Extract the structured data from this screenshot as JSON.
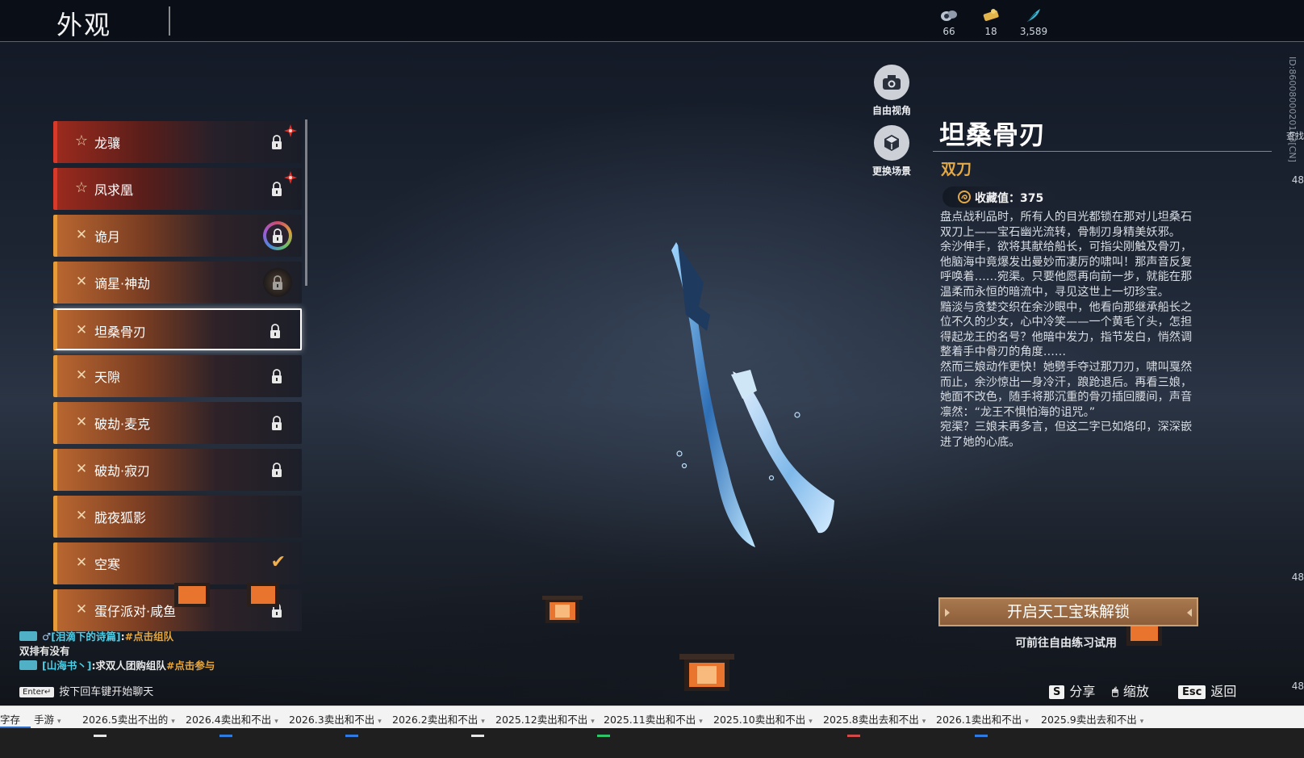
{
  "header": {
    "title": "外观",
    "currencies": [
      {
        "icon": "crystal-icon",
        "value": "66"
      },
      {
        "icon": "ticket-icon",
        "value": "18"
      },
      {
        "icon": "feather-icon",
        "value": "3,589"
      }
    ],
    "side_id": "ID:8600800020163[CN]",
    "edge_numbers": [
      "48",
      "48",
      "48"
    ],
    "edge_text": "查找"
  },
  "list": {
    "items": [
      {
        "label": "龙骧",
        "icon": "star-icon",
        "rarity": "red",
        "state": "locked",
        "new_badge": true
      },
      {
        "label": "凤求凰",
        "icon": "star-icon",
        "rarity": "red",
        "state": "locked",
        "new_badge": true
      },
      {
        "label": "诡月",
        "icon": "shuriken-icon",
        "rarity": "orange",
        "state": "locked-ring"
      },
      {
        "label": "谪星·神劫",
        "icon": "shuriken-icon",
        "rarity": "orange",
        "state": "locked-dark"
      },
      {
        "label": "坦桑骨刃",
        "icon": "shuriken-icon",
        "rarity": "orange",
        "state": "locked",
        "selected": true
      },
      {
        "label": "天隙",
        "icon": "shuriken-icon",
        "rarity": "orange",
        "state": "locked"
      },
      {
        "label": "破劫·麦克",
        "icon": "shuriken-icon",
        "rarity": "orange",
        "state": "locked"
      },
      {
        "label": "破劫·寂刃",
        "icon": "shuriken-icon",
        "rarity": "orange",
        "state": "locked"
      },
      {
        "label": "胧夜狐影",
        "icon": "shuriken-icon",
        "rarity": "orange",
        "state": "none"
      },
      {
        "label": "空寒",
        "icon": "shuriken-icon",
        "rarity": "orange",
        "state": "equipped"
      },
      {
        "label": "蛋仔派对·咸鱼",
        "icon": "shuriken-icon",
        "rarity": "orange",
        "state": "locked"
      }
    ]
  },
  "camera": {
    "free_view": "自由视角",
    "change_scene": "更换场景"
  },
  "detail": {
    "name": "坦桑骨刃",
    "type": "双刀",
    "collection_label": "收藏值：375",
    "description": [
      "盘点战利品时，所有人的目光都锁在那对儿坦桑石双刀上——宝石幽光流转，骨制刃身精美妖邪。",
      "余沙伸手，欲将其献给船长，可指尖刚触及骨刃，他脑海中竟爆发出曼妙而凄厉的啸叫！那声音反复呼唤着……宛渠。只要他愿再向前一步，就能在那温柔而永恒的暗流中，寻见这世上一切珍宝。",
      "黯淡与贪婪交织在余沙眼中，他看向那继承船长之位不久的少女，心中冷笑——一个黄毛丫头，怎担得起龙王的名号？他暗中发力，指节发白，悄然调整着手中骨刃的角度……",
      "然而三娘动作更快！她劈手夺过那刀刃，啸叫戛然而止，余沙惊出一身冷汗，踉跄退后。再看三娘，她面不改色，随手将那沉重的骨刃插回腰间，声音凛然：“龙王不惧怕海的诅咒。”",
      "宛渠？三娘未再多言，但这二字已如烙印，深深嵌进了她的心底。"
    ],
    "unlock_button": "开启天工宝珠解锁",
    "trial_hint": "可前往自由练习试用"
  },
  "chat": {
    "lines": [
      {
        "prefix": "♂",
        "channel": "[泪滴下的诗篇]",
        "text": ":",
        "link": "#点击组队"
      },
      {
        "prefix": "",
        "channel": "",
        "text": "双排有没有",
        "link": ""
      },
      {
        "prefix": "",
        "channel": "[山海书丶]",
        "text": ":求双人团购组队",
        "link": "#点击参与"
      }
    ],
    "enter_key": "Enter↵",
    "enter_hint": "按下回车键开始聊天"
  },
  "hints": [
    {
      "key": "S",
      "label": "分享"
    },
    {
      "key": "🖱",
      "label": "缩放"
    },
    {
      "key": "Esc",
      "label": "返回"
    }
  ],
  "bookmarks": [
    "字存",
    "手游",
    "2026.5卖出不出的",
    "2026.4卖出和不出",
    "2026.3卖出和不出",
    "2026.2卖出和不出",
    "2025.12卖出和不出",
    "2025.11卖出和不出",
    "2025.10卖出和不出",
    "2025.8卖出去和不出",
    "2026.1卖出和不出",
    "2025.9卖出去和不出"
  ],
  "colors": {
    "accent_gold": "#e3a949",
    "red_rarity": "#d63a2a",
    "orange_rarity": "#e79a3a",
    "chat_channel": "#4ad0e8",
    "chat_link": "#e6a63e",
    "unlock_button": "#9a6a44"
  }
}
